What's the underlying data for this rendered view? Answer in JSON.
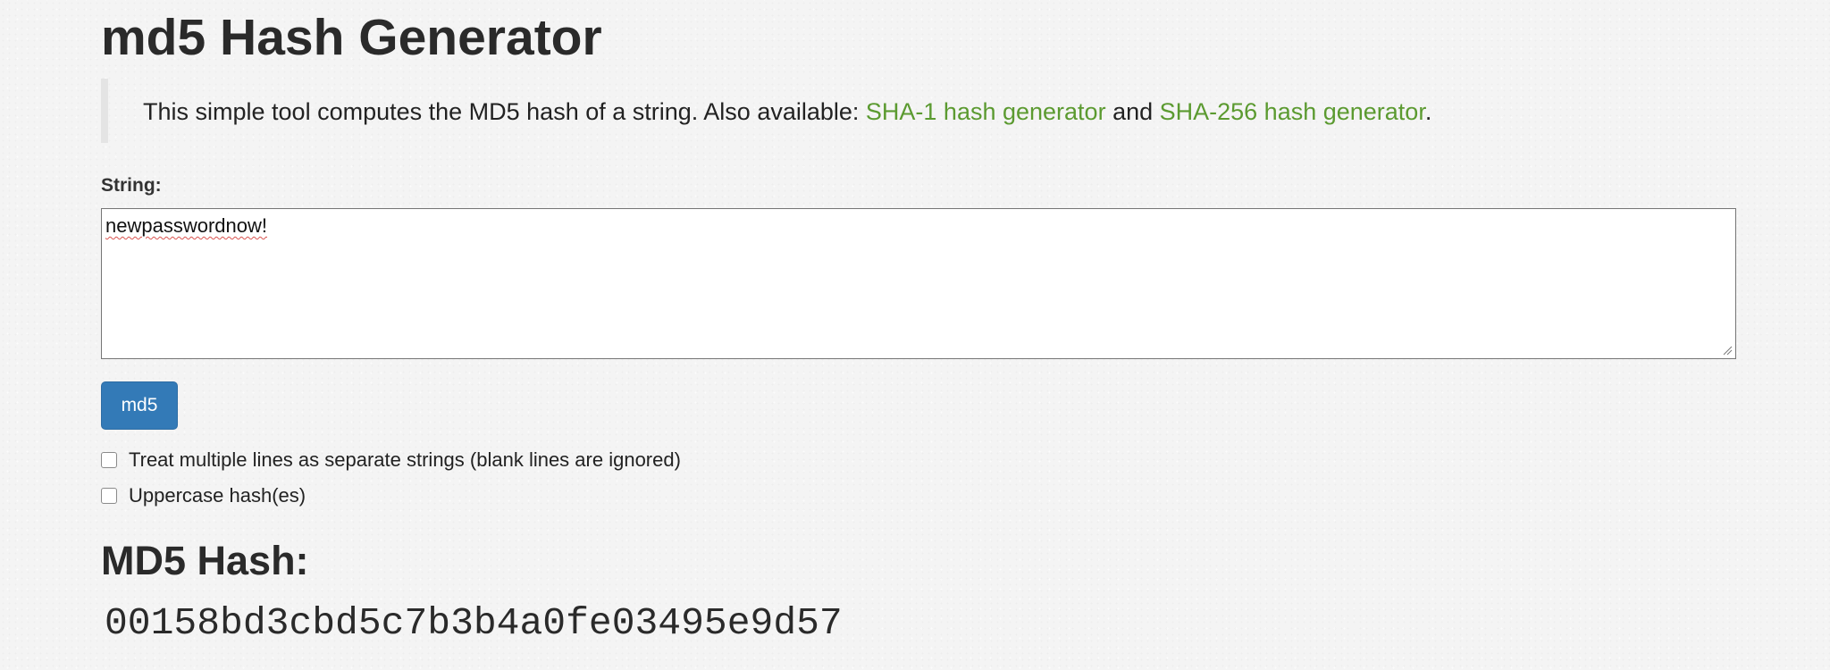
{
  "page": {
    "title": "md5 Hash Generator"
  },
  "intro": {
    "text_before": "This simple tool computes the MD5 hash of a string. Also available: ",
    "link1": "SHA-1 hash generator",
    "text_between": " and ",
    "link2": "SHA-256 hash generator",
    "text_after": ".",
    "link_color": "#5b9a30"
  },
  "form": {
    "string_label": "String:",
    "string_value": "newpasswordnow!",
    "button_label": "md5",
    "button_color": "#337ab7",
    "options": [
      {
        "label": "Treat multiple lines as separate strings (blank lines are ignored)",
        "checked": false
      },
      {
        "label": "Uppercase hash(es)",
        "checked": false
      }
    ]
  },
  "result": {
    "heading": "MD5 Hash:",
    "hash": "00158bd3cbd5c7b3b4a0fe03495e9d57"
  }
}
